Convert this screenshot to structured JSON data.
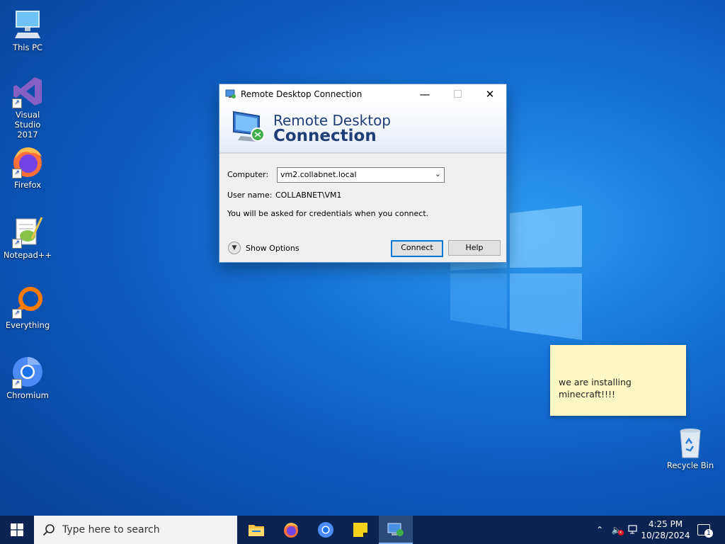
{
  "desktop": {
    "icons": [
      {
        "label": "This PC"
      },
      {
        "label": "Visual Studio\n2017"
      },
      {
        "label": "Firefox"
      },
      {
        "label": "Notepad++"
      },
      {
        "label": "Everything"
      },
      {
        "label": "Chromium"
      },
      {
        "label": "Recycle Bin"
      }
    ]
  },
  "rdc": {
    "title": "Remote Desktop Connection",
    "banner_line1": "Remote Desktop",
    "banner_line2": "Connection",
    "computer_label": "Computer:",
    "computer_value": "vm2.collabnet.local",
    "username_label": "User name:",
    "username_value": "COLLABNET\\VM1",
    "info_text": "You will be asked for credentials when you connect.",
    "show_options": "Show Options",
    "connect": "Connect",
    "help": "Help"
  },
  "sticky": {
    "text": "we are installing minecraft!!!!"
  },
  "taskbar": {
    "search_placeholder": "Type here to search",
    "time": "4:25 PM",
    "date": "10/28/2024",
    "notification_count": "1"
  },
  "colors": {
    "accent": "#0078d7",
    "taskbar": "#0b2352",
    "sticky": "#fdf7c3",
    "banner_text": "#1f3e75"
  }
}
